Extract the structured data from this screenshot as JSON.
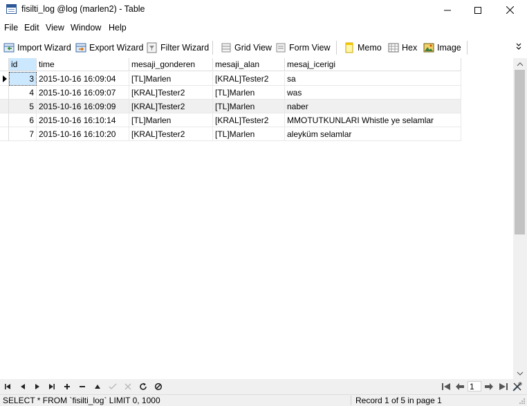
{
  "window": {
    "title": "fisilti_log @log (marlen2) - Table",
    "minimize": "—",
    "maximize": "☐",
    "close": "✕"
  },
  "menu": [
    {
      "label": "File"
    },
    {
      "label": "Edit"
    },
    {
      "label": "View"
    },
    {
      "label": "Window"
    },
    {
      "label": "Help"
    }
  ],
  "toolbar": {
    "import_wizard": "Import Wizard",
    "export_wizard": "Export Wizard",
    "filter_wizard": "Filter Wizard",
    "grid_view": "Grid View",
    "form_view": "Form View",
    "memo": "Memo",
    "hex": "Hex",
    "image": "Image"
  },
  "table": {
    "columns": [
      "id",
      "time",
      "mesaji_gonderen",
      "mesaji_alan",
      "mesaj_icerigi"
    ],
    "rows": [
      {
        "id": "3",
        "time": "2015-10-16 16:09:04",
        "mesaji_gonderen": "[TL]Marlen",
        "mesaji_alan": "[KRAL]Tester2",
        "mesaj_icerigi": "sa"
      },
      {
        "id": "4",
        "time": "2015-10-16 16:09:07",
        "mesaji_gonderen": "[KRAL]Tester2",
        "mesaji_alan": "[TL]Marlen",
        "mesaj_icerigi": "was"
      },
      {
        "id": "5",
        "time": "2015-10-16 16:09:09",
        "mesaji_gonderen": "[KRAL]Tester2",
        "mesaji_alan": "[TL]Marlen",
        "mesaj_icerigi": "naber"
      },
      {
        "id": "6",
        "time": "2015-10-16 16:10:14",
        "mesaji_gonderen": "[TL]Marlen",
        "mesaji_alan": "[KRAL]Tester2",
        "mesaj_icerigi": "MMOTUTKUNLARI Whistle ye selamlar"
      },
      {
        "id": "7",
        "time": "2015-10-16 16:10:20",
        "mesaji_gonderen": "[KRAL]Tester2",
        "mesaji_alan": "[TL]Marlen",
        "mesaj_icerigi": "aleyküm selamlar"
      }
    ],
    "selected_row": 0
  },
  "navigation": {
    "page_value": "1"
  },
  "status": {
    "query": "SELECT * FROM `fisilti_log` LIMIT 0, 1000",
    "record": "Record 1 of 5 in page 1"
  },
  "colors": {
    "selection": "#cce8ff",
    "alt_row": "#f0f0f0",
    "chrome": "#f0f0f0"
  }
}
